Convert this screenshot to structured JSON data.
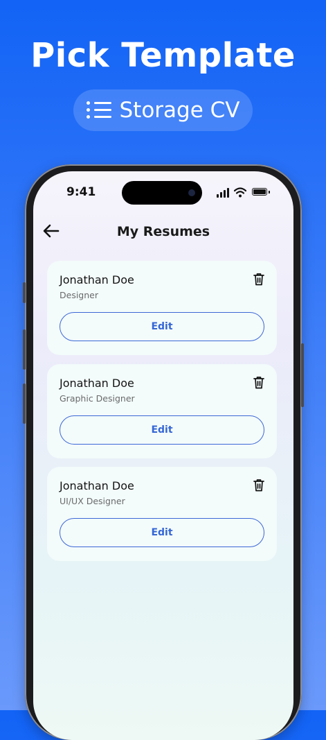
{
  "headline": "Pick Template",
  "badge": {
    "icon": "list-icon",
    "label": "Storage CV"
  },
  "status_bar": {
    "time": "9:41"
  },
  "header": {
    "title": "My Resumes",
    "back_icon": "arrow-left-icon"
  },
  "resumes": [
    {
      "name": "Jonathan Doe",
      "role": "Designer",
      "edit_label": "Edit"
    },
    {
      "name": "Jonathan Doe",
      "role": "Graphic Designer",
      "edit_label": "Edit"
    },
    {
      "name": "Jonathan Doe",
      "role": "UI/UX Designer",
      "edit_label": "Edit"
    }
  ],
  "colors": {
    "background": "#1263f6",
    "accent": "#3466d6",
    "card": "#f3fbfb"
  }
}
